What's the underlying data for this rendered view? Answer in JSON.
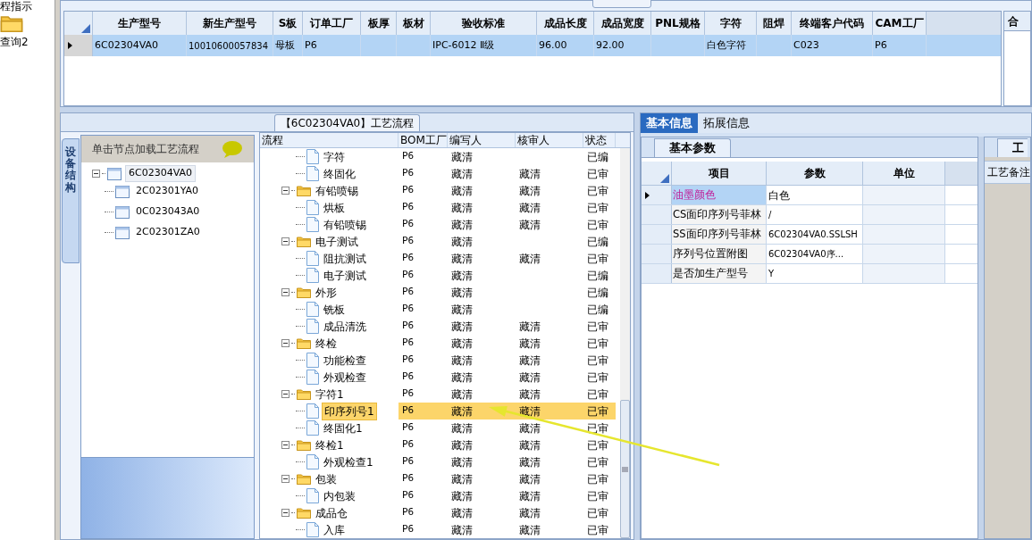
{
  "sidebar": {
    "items": [
      {
        "label": "程指示",
        "kind": "text"
      },
      {
        "label": "查询2",
        "kind": "folder"
      }
    ]
  },
  "top_grid": {
    "columns": [
      "生产型号",
      "新生产型号",
      "S板",
      "订单工厂",
      "板厚",
      "板材",
      "验收标准",
      "成品长度",
      "成品宽度",
      "PNL规格",
      "字符",
      "阻焊",
      "终端客户代码",
      "CAM工厂"
    ],
    "rows": [
      {
        "selected": true,
        "cells": [
          "6C02304VA0",
          "10010600057834",
          "母板",
          "P6",
          "",
          "",
          "IPC-6012 Ⅱ级",
          "96.00",
          "92.00",
          "",
          "白色字符",
          "",
          "C023",
          "P6"
        ]
      }
    ],
    "side_header": "合"
  },
  "process_panel": {
    "title": "【6C02304VA0】工艺流程",
    "vertical_tab": "设备结构",
    "hint": "单击节点加载工艺流程",
    "structure_tree": [
      {
        "label": "6C02304VA0",
        "selected": true,
        "children": [
          {
            "label": "2C02301YA0",
            "selected": false
          },
          {
            "label": "0C023043A0",
            "selected": false
          },
          {
            "label": "2C02301ZA0",
            "selected": false
          }
        ]
      }
    ],
    "columns": [
      "流程",
      "BOM工厂",
      "编写人",
      "核审人",
      "状态"
    ],
    "rows": [
      {
        "kind": "file",
        "label": "字符",
        "bom": "P6",
        "writer": "藏清",
        "status": "已编",
        "selected": false
      },
      {
        "kind": "file",
        "label": "终固化",
        "bom": "P6",
        "writer": "藏清",
        "reviewer": "藏清",
        "status": "已审",
        "selected": false
      },
      {
        "kind": "folder",
        "label": "有铅喷锡",
        "bom": "P6",
        "writer": "藏清",
        "reviewer": "藏清",
        "status": "已审",
        "selected": false,
        "children": [
          {
            "kind": "file",
            "label": "烘板",
            "bom": "P6",
            "writer": "藏清",
            "reviewer": "藏清",
            "status": "已审",
            "selected": false
          },
          {
            "kind": "file",
            "label": "有铅喷锡",
            "bom": "P6",
            "writer": "藏清",
            "reviewer": "藏清",
            "status": "已审",
            "selected": false
          }
        ]
      },
      {
        "kind": "folder",
        "label": "电子测试",
        "bom": "P6",
        "writer": "藏清",
        "status": "已编",
        "selected": false,
        "children": [
          {
            "kind": "file",
            "label": "阻抗测试",
            "bom": "P6",
            "writer": "藏清",
            "reviewer": "藏清",
            "status": "已审",
            "selected": false
          },
          {
            "kind": "file",
            "label": "电子测试",
            "bom": "P6",
            "writer": "藏清",
            "status": "已编",
            "selected": false
          }
        ]
      },
      {
        "kind": "folder",
        "label": "外形",
        "bom": "P6",
        "writer": "藏清",
        "status": "已编",
        "selected": false,
        "children": [
          {
            "kind": "file",
            "label": "铣板",
            "bom": "P6",
            "writer": "藏清",
            "status": "已编",
            "selected": false
          },
          {
            "kind": "file",
            "label": "成品清洗",
            "bom": "P6",
            "writer": "藏清",
            "reviewer": "藏清",
            "status": "已审",
            "selected": false
          }
        ]
      },
      {
        "kind": "folder",
        "label": "终检",
        "bom": "P6",
        "writer": "藏清",
        "reviewer": "藏清",
        "status": "已审",
        "selected": false,
        "children": [
          {
            "kind": "file",
            "label": "功能检查",
            "bom": "P6",
            "writer": "藏清",
            "reviewer": "藏清",
            "status": "已审",
            "selected": false
          },
          {
            "kind": "file",
            "label": "外观检查",
            "bom": "P6",
            "writer": "藏清",
            "reviewer": "藏清",
            "status": "已审",
            "selected": false
          }
        ]
      },
      {
        "kind": "folder",
        "label": "字符1",
        "bom": "P6",
        "writer": "藏清",
        "reviewer": "藏清",
        "status": "已审",
        "selected": false,
        "children": [
          {
            "kind": "file",
            "label": "印序列号1",
            "bom": "P6",
            "writer": "藏清",
            "reviewer": "藏清",
            "status": "已审",
            "selected": true
          },
          {
            "kind": "file",
            "label": "终固化1",
            "bom": "P6",
            "writer": "藏清",
            "reviewer": "藏清",
            "status": "已审",
            "selected": false
          }
        ]
      },
      {
        "kind": "folder",
        "label": "终检1",
        "bom": "P6",
        "writer": "藏清",
        "reviewer": "藏清",
        "status": "已审",
        "selected": false,
        "children": [
          {
            "kind": "file",
            "label": "外观检查1",
            "bom": "P6",
            "writer": "藏清",
            "reviewer": "藏清",
            "status": "已审",
            "selected": false
          }
        ]
      },
      {
        "kind": "folder",
        "label": "包装",
        "bom": "P6",
        "writer": "藏清",
        "reviewer": "藏清",
        "status": "已审",
        "selected": false,
        "children": [
          {
            "kind": "file",
            "label": "内包装",
            "bom": "P6",
            "writer": "藏清",
            "reviewer": "藏清",
            "status": "已审",
            "selected": false
          }
        ]
      },
      {
        "kind": "folder",
        "label": "成品仓",
        "bom": "P6",
        "writer": "藏清",
        "reviewer": "藏清",
        "status": "已审",
        "selected": false,
        "children": [
          {
            "kind": "file",
            "label": "入库",
            "bom": "P6",
            "writer": "藏清",
            "reviewer": "藏清",
            "status": "已审",
            "selected": false
          }
        ]
      }
    ]
  },
  "info_panel": {
    "tabs": [
      {
        "label": "基本信息",
        "selected": true
      },
      {
        "label": "拓展信息",
        "selected": false
      }
    ],
    "sub_tab": "基本参数",
    "columns": [
      "项目",
      "参数",
      "单位"
    ],
    "rows": [
      {
        "item": "油墨颜色",
        "value": "白色",
        "selected": true
      },
      {
        "item": "CS面印序列号菲林",
        "value": "/",
        "selected": false
      },
      {
        "item": "SS面印序列号菲林",
        "value": "6C02304VA0.SSLSH",
        "selected": false
      },
      {
        "item": "序列号位置附图",
        "value": "6C02304VA0序...",
        "selected": false
      },
      {
        "item": "是否加生产型号",
        "value": "Y",
        "selected": false
      }
    ],
    "side_tab": "工",
    "side_header": "工艺备注"
  }
}
